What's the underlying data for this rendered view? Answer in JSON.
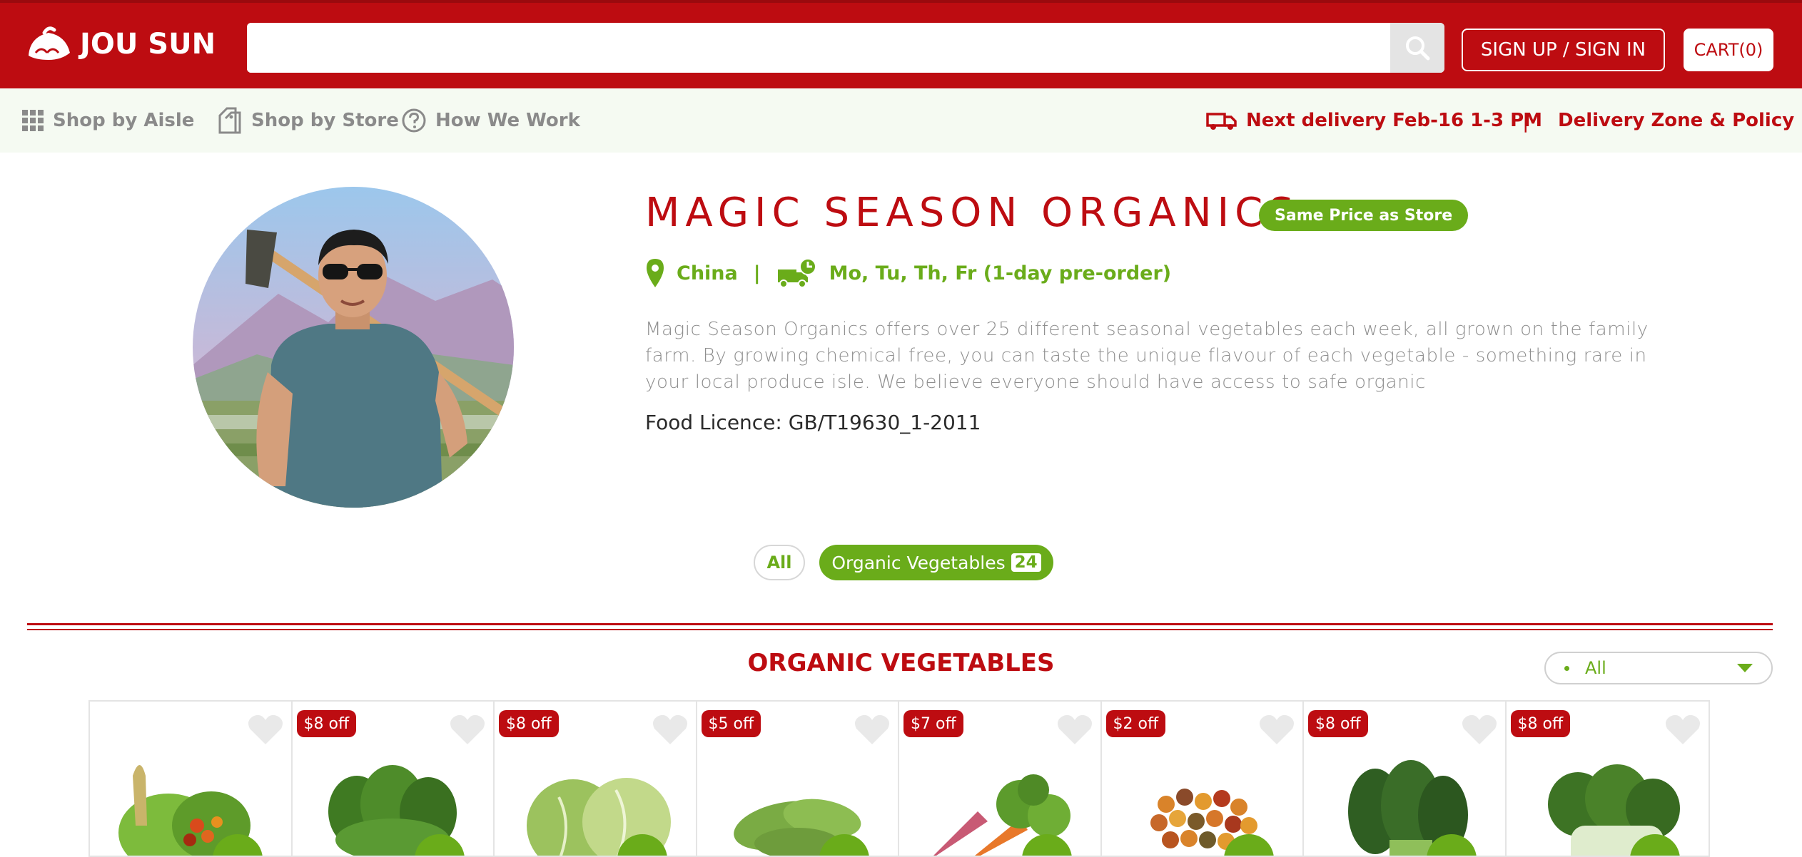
{
  "brand": {
    "name": "JOU SUN"
  },
  "search": {
    "value": "",
    "placeholder": ""
  },
  "header": {
    "sign_label": "SIGN UP / SIGN IN",
    "cart_label": "CART(0)"
  },
  "nav": {
    "items": [
      {
        "label": "Shop by Aisle",
        "icon": "grid-icon"
      },
      {
        "label": "Shop by Store",
        "icon": "store-tags-icon"
      },
      {
        "label": "How We Work",
        "icon": "question-circle-icon"
      }
    ],
    "delivery_text": "Next delivery Feb-16 1-3 PM",
    "separator": "|",
    "zone_link": "Delivery Zone & Policy"
  },
  "store": {
    "name": "MAGIC SEASON ORGANICS",
    "price_badge": "Same Price as Store",
    "location": "China",
    "meta_separator": "|",
    "schedule": "Mo, Tu, Th, Fr (1-day pre-order)",
    "description": "Magic Season Organics offers over 25 different seasonal vegetables each week, all grown on the family farm. By growing chemical free, you can taste the unique flavour of each vegetable - something rare in your local produce isle. We believe everyone should have access to safe organic",
    "licence": "Food Licence: GB/T19630_1-2011"
  },
  "filters": {
    "all_label": "All",
    "category_label": "Organic Vegetables",
    "category_count": "24"
  },
  "section": {
    "title": "ORGANIC VEGETABLES",
    "sort_value": "All"
  },
  "products": [
    {
      "discount": "",
      "kind": "mixed"
    },
    {
      "discount": "$8 off",
      "kind": "greens"
    },
    {
      "discount": "$8 off",
      "kind": "cabbage"
    },
    {
      "discount": "$5 off",
      "kind": "peas"
    },
    {
      "discount": "$7 off",
      "kind": "carrot"
    },
    {
      "discount": "$2 off",
      "kind": "tomatoes"
    },
    {
      "discount": "$8 off",
      "kind": "choysum"
    },
    {
      "discount": "$8 off",
      "kind": "bokchoy"
    }
  ],
  "colors": {
    "brand_red": "#bd0c11",
    "accent_green": "#6aac1a",
    "subnav_bg": "#f5faf2"
  }
}
